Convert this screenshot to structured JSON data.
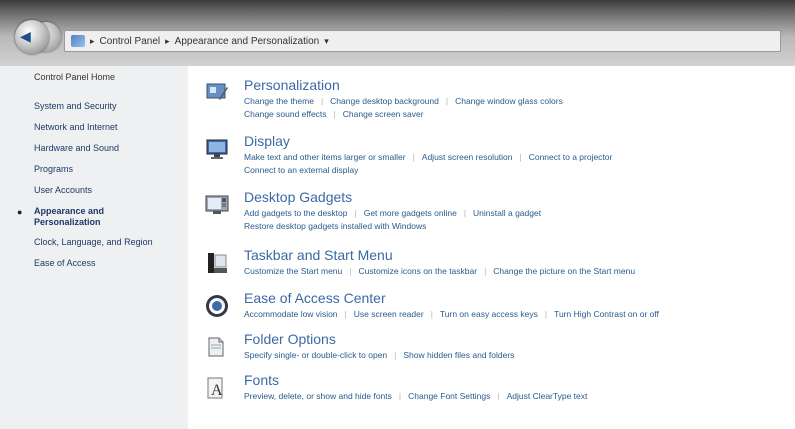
{
  "breadcrumb": {
    "items": [
      "Control Panel",
      "Appearance and Personalization"
    ]
  },
  "sidebar": {
    "home": "Control Panel Home",
    "items": [
      {
        "label": "System and Security"
      },
      {
        "label": "Network and Internet"
      },
      {
        "label": "Hardware and Sound"
      },
      {
        "label": "Programs"
      },
      {
        "label": "User Accounts"
      },
      {
        "label": "Appearance and Personalization",
        "active": true
      },
      {
        "label": "Clock, Language, and Region"
      },
      {
        "label": "Ease of Access"
      }
    ]
  },
  "categories": [
    {
      "title": "Personalization",
      "icon": "personalization-icon",
      "links": [
        [
          "Change the theme",
          "Change desktop background",
          "Change window glass colors"
        ],
        [
          "Change sound effects",
          "Change screen saver"
        ]
      ]
    },
    {
      "title": "Display",
      "icon": "display-icon",
      "links": [
        [
          "Make text and other items larger or smaller",
          "Adjust screen resolution",
          "Connect to a projector"
        ],
        [
          "Connect to an external display"
        ]
      ]
    },
    {
      "title": "Desktop Gadgets",
      "icon": "gadgets-icon",
      "links": [
        [
          "Add gadgets to the desktop",
          "Get more gadgets online",
          "Uninstall a gadget"
        ],
        [
          "Restore desktop gadgets installed with Windows"
        ]
      ]
    },
    {
      "title": "Taskbar and Start Menu",
      "icon": "taskbar-icon",
      "links": [
        [
          "Customize the Start menu",
          "Customize icons on the taskbar",
          "Change the picture on the Start menu"
        ]
      ]
    },
    {
      "title": "Ease of Access Center",
      "icon": "ease-of-access-icon",
      "links": [
        [
          "Accommodate low vision",
          "Use screen reader",
          "Turn on easy access keys",
          "Turn High Contrast on or off"
        ]
      ]
    },
    {
      "title": "Folder Options",
      "icon": "folder-options-icon",
      "links": [
        [
          "Specify single- or double-click to open",
          "Show hidden files and folders"
        ]
      ]
    },
    {
      "title": "Fonts",
      "icon": "fonts-icon",
      "links": [
        [
          "Preview, delete, or show and hide fonts",
          "Change Font Settings",
          "Adjust ClearType text"
        ]
      ]
    }
  ]
}
